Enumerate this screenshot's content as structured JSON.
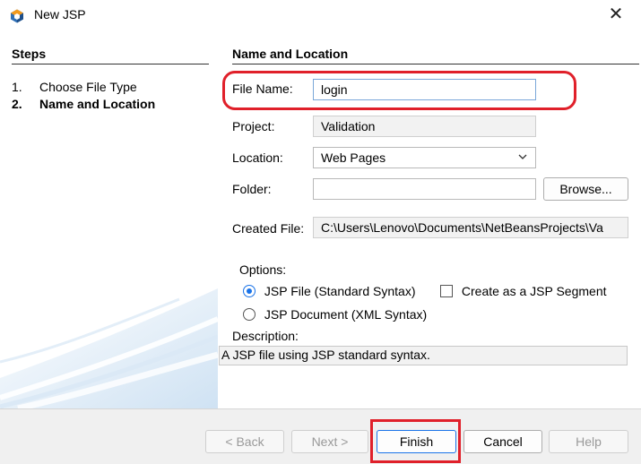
{
  "window": {
    "title": "New JSP",
    "close_glyph": "✕"
  },
  "steps": {
    "title": "Steps",
    "items": [
      {
        "num": "1.",
        "label": "Choose File Type"
      },
      {
        "num": "2.",
        "label": "Name and Location"
      }
    ]
  },
  "form": {
    "section_title": "Name and Location",
    "file_name_label": "File Name:",
    "file_name_value": "login",
    "project_label": "Project:",
    "project_value": "Validation",
    "location_label": "Location:",
    "location_value": "Web Pages",
    "folder_label": "Folder:",
    "folder_value": "",
    "browse_label": "Browse...",
    "created_file_label": "Created File:",
    "created_file_value": "C:\\Users\\Lenovo\\Documents\\NetBeansProjects\\Va"
  },
  "options": {
    "title": "Options:",
    "jsp_file_label": "JSP File (Standard Syntax)",
    "jsp_document_label": "JSP Document (XML Syntax)",
    "segment_label": "Create as a JSP Segment",
    "selected": "jsp_file"
  },
  "description": {
    "title": "Description:",
    "text": "A JSP file using JSP standard syntax."
  },
  "footer": {
    "back_label": "< Back",
    "next_label": "Next >",
    "finish_label": "Finish",
    "cancel_label": "Cancel",
    "help_label": "Help"
  },
  "colors": {
    "highlight": "#e0202a",
    "radio_accent": "#1a73e8",
    "icon_blue": "#2f6fb5",
    "icon_orange": "#f29a1d"
  },
  "icons": {
    "app": "netbeans-cube-icon",
    "location_dropdown": "chevron-down-icon"
  }
}
